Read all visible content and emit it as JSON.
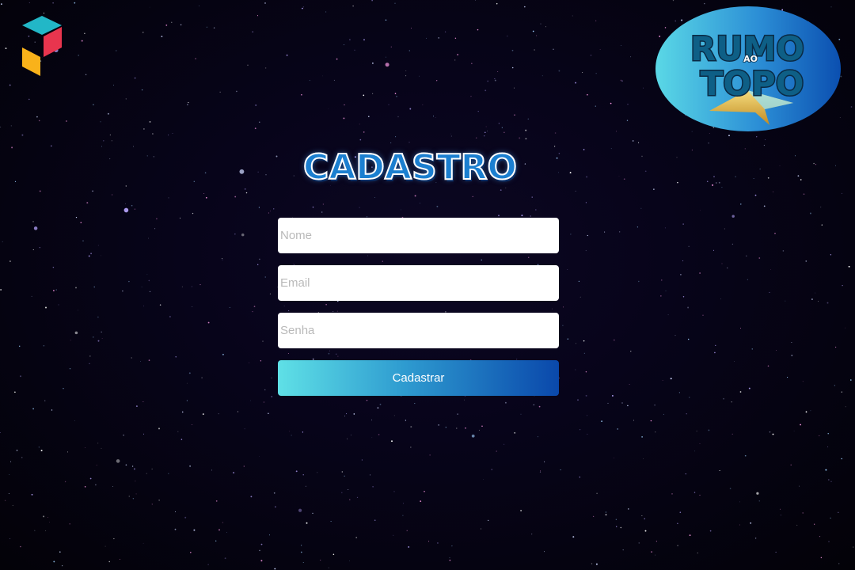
{
  "page": {
    "title": "CADASTRO"
  },
  "brand": {
    "badge_text_line1": "RUMO",
    "badge_text_small": "AO",
    "badge_text_line2": "TOPO",
    "app_logo_icon": "cube-logo-icon"
  },
  "form": {
    "name_placeholder": "Nome",
    "name_value": "",
    "email_placeholder": "Email",
    "email_value": "",
    "password_placeholder": "Senha",
    "password_value": "",
    "submit_label": "Cadastrar"
  },
  "colors": {
    "background": "#05030d",
    "title": "#1b7fd0",
    "button_gradient_start": "#5fe0e6",
    "button_gradient_end": "#0a48ab"
  }
}
